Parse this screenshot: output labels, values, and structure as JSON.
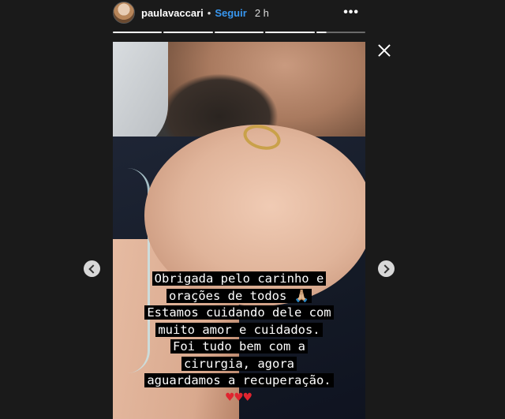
{
  "header": {
    "username": "paulavaccari",
    "separator": "•",
    "follow_label": "Seguir",
    "time": "2 h",
    "more_glyph": "•••"
  },
  "progress": {
    "segments": 5,
    "current_index": 4,
    "current_fraction": 0.2
  },
  "story": {
    "caption_lines": [
      "Obrigada pelo carinho e",
      "orações de todos 🙏🏼",
      "Estamos cuidando dele com",
      "muito amor e cuidados.",
      "Foi tudo bem com a",
      "cirurgia, agora",
      "aguardamos a recuperação."
    ],
    "hearts": "♥♥♥"
  },
  "controls": {
    "close_icon": "close-icon",
    "prev_icon": "chevron-left-icon",
    "next_icon": "chevron-right-icon"
  },
  "colors": {
    "background": "#1a1a1a",
    "follow": "#3897f0",
    "heart": "#e0242f",
    "nav_button": "#d8d8d8"
  }
}
